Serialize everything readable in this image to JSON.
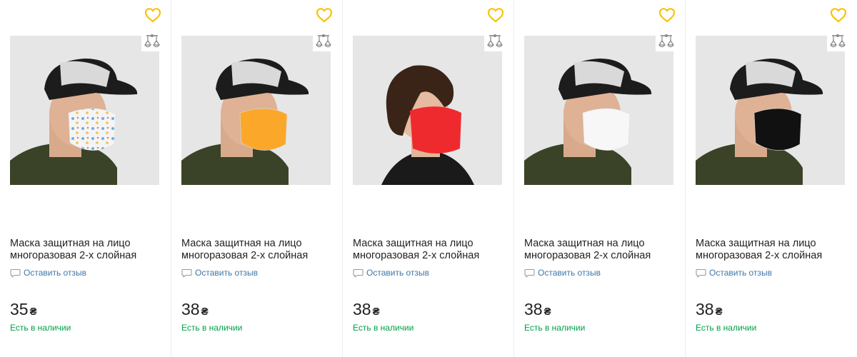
{
  "colors": {
    "heart": "#f8c300",
    "review_link": "#3e77aa",
    "in_stock": "#00a046",
    "text": "#221f1f"
  },
  "products": [
    {
      "title": "Маска защитная на лицо многоразовая 2-х слойная",
      "review_link": "Оставить отзыв",
      "price": "35",
      "currency": "₴",
      "availability": "Есть в наличии",
      "mask_color": "white-patterned",
      "model": "man"
    },
    {
      "title": "Маска защитная на лицо многоразовая 2-х слойная",
      "review_link": "Оставить отзыв",
      "price": "38",
      "currency": "₴",
      "availability": "Есть в наличии",
      "mask_color": "orange",
      "model": "man"
    },
    {
      "title": "Маска защитная на лицо многоразовая 2-х слойная",
      "review_link": "Оставить отзыв",
      "price": "38",
      "currency": "₴",
      "availability": "Есть в наличии",
      "mask_color": "red",
      "model": "woman"
    },
    {
      "title": "Маска защитная на лицо многоразовая 2-х слойная",
      "review_link": "Оставить отзыв",
      "price": "38",
      "currency": "₴",
      "availability": "Есть в наличии",
      "mask_color": "white",
      "model": "man"
    },
    {
      "title": "Маска защитная на лицо многоразовая 2-х слойная",
      "review_link": "Оставить отзыв",
      "price": "38",
      "currency": "₴",
      "availability": "Есть в наличии",
      "mask_color": "black",
      "model": "man"
    }
  ]
}
